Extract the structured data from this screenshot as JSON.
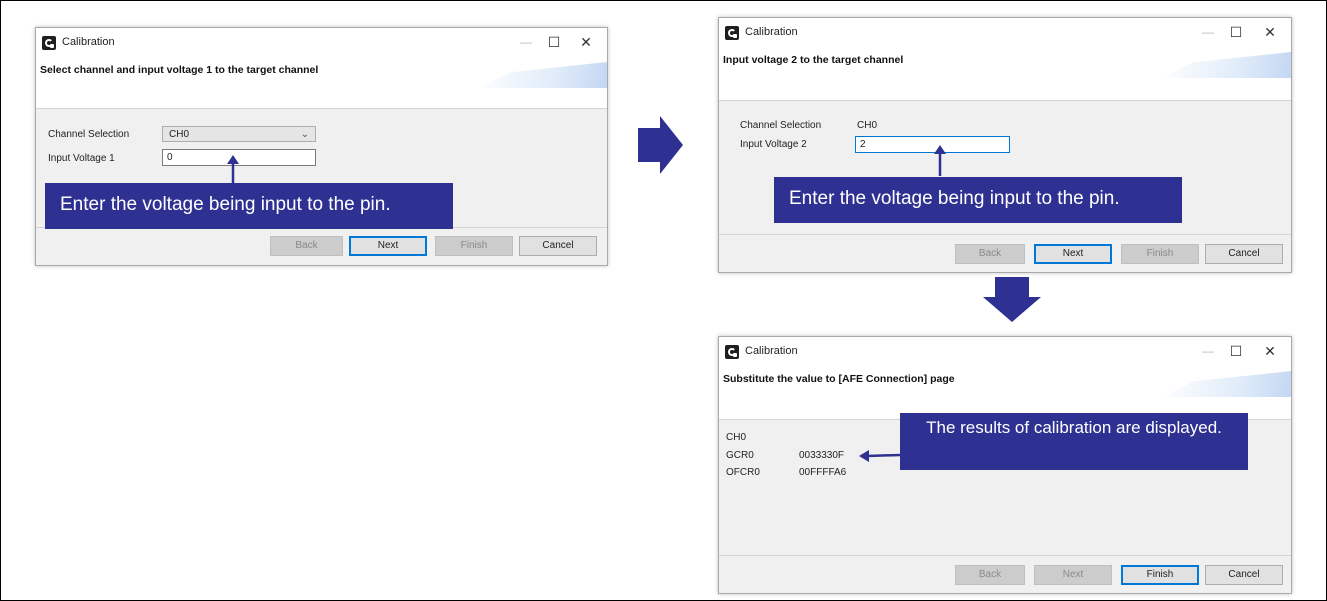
{
  "colors": {
    "callout_bg": "#2e3192",
    "flow_arrow": "#2e3192",
    "focus_border": "#0078d7"
  },
  "window_title": "Calibration",
  "buttons": {
    "back": "Back",
    "next": "Next",
    "finish": "Finish",
    "cancel": "Cancel"
  },
  "step1": {
    "heading": "Select channel and input voltage 1 to the target channel",
    "channel_label": "Channel Selection",
    "channel_value": "CH0",
    "voltage_label": "Input Voltage 1",
    "voltage_value": "0",
    "callout": "Enter the voltage being input to the pin."
  },
  "step2": {
    "heading": "Input voltage 2 to the target channel",
    "channel_label": "Channel Selection",
    "channel_value": "CH0",
    "voltage_label": "Input Voltage 2",
    "voltage_value": "2",
    "callout": "Enter the voltage being input to the pin."
  },
  "step3": {
    "heading": "Substitute the value to [AFE Connection] page",
    "channel": "CH0",
    "gcr_label": "GCR0",
    "gcr_value": "0033330F",
    "ofcr_label": "OFCR0",
    "ofcr_value": "00FFFFA6",
    "callout": "The results of calibration are displayed."
  }
}
